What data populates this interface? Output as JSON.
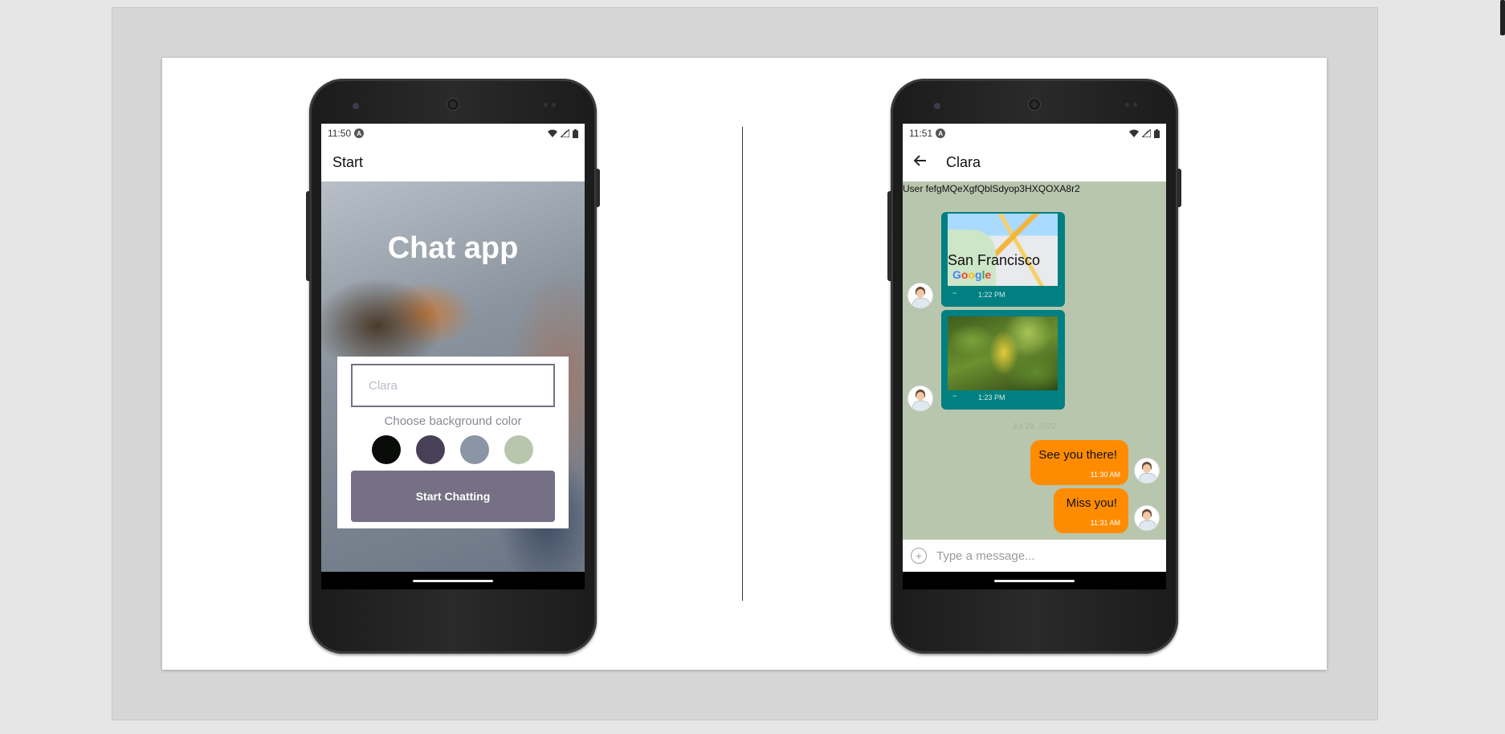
{
  "start_screen": {
    "status_time": "11:50",
    "app_bar_title": "Start",
    "hero_title": "Chat app",
    "name_input": {
      "value": "",
      "placeholder": "Clara"
    },
    "color_label": "Choose background color",
    "color_options": [
      "#090c08",
      "#474056",
      "#8a95a5",
      "#b9c6ae"
    ],
    "start_button_label": "Start Chatting"
  },
  "chat_screen": {
    "status_time": "11:51",
    "app_bar_title": "Clara",
    "system_message": "User fefgMQeXgfQblSdyop3HXQOXA8r2",
    "background_color": "#b9c6ae",
    "map_message": {
      "city_label": "San Francisco",
      "brand": "Google",
      "sender": "~",
      "time": "1:22 PM"
    },
    "image_message": {
      "sender": "~",
      "time": "1:23 PM"
    },
    "day_separator": "Jul 29, 2022",
    "messages": [
      {
        "text": "See you there!",
        "time": "11:30 AM"
      },
      {
        "text": "Miss you!",
        "time": "11:31 AM"
      }
    ],
    "composer": {
      "placeholder": "Type a message..."
    }
  },
  "colors": {
    "accent_orange": "#ff8c00",
    "teal_bubble": "#008080",
    "button_purple": "#757083"
  }
}
